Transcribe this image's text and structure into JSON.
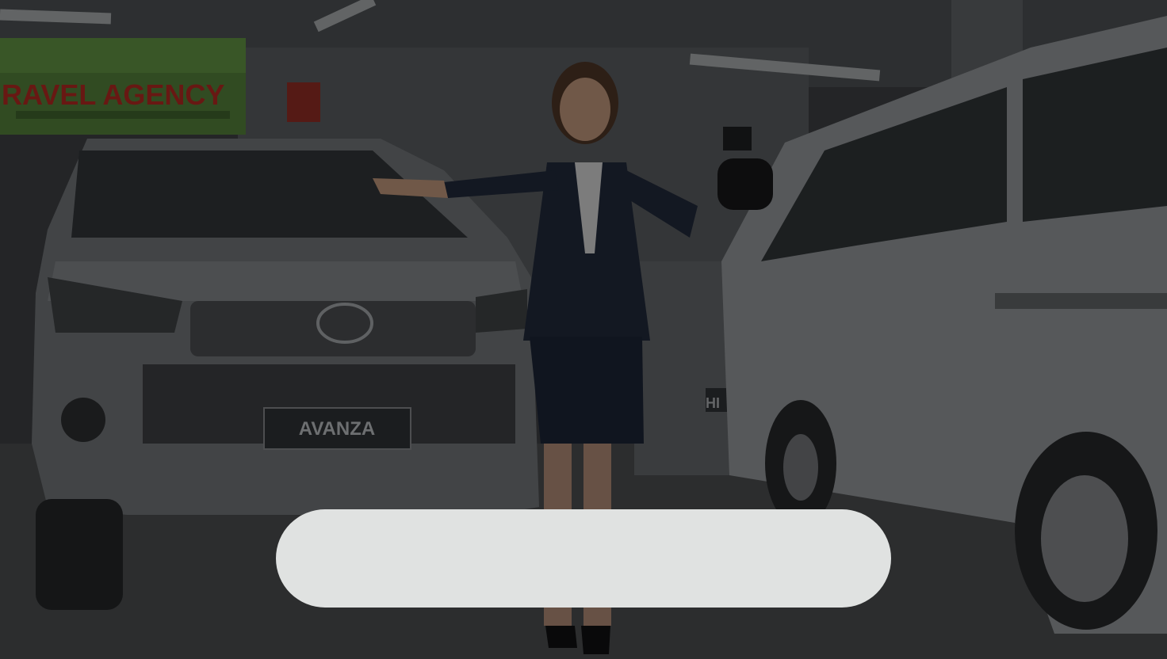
{
  "scene": {
    "sign_text": "RAVEL AGENCY",
    "plate_text": "AVANZA",
    "side_text": "HI"
  },
  "overlay_card": {
    "text": ""
  },
  "colors": {
    "sign_green": "#6fb84a",
    "sign_red": "#d8322a",
    "card_bg": "#e0e2e1"
  }
}
